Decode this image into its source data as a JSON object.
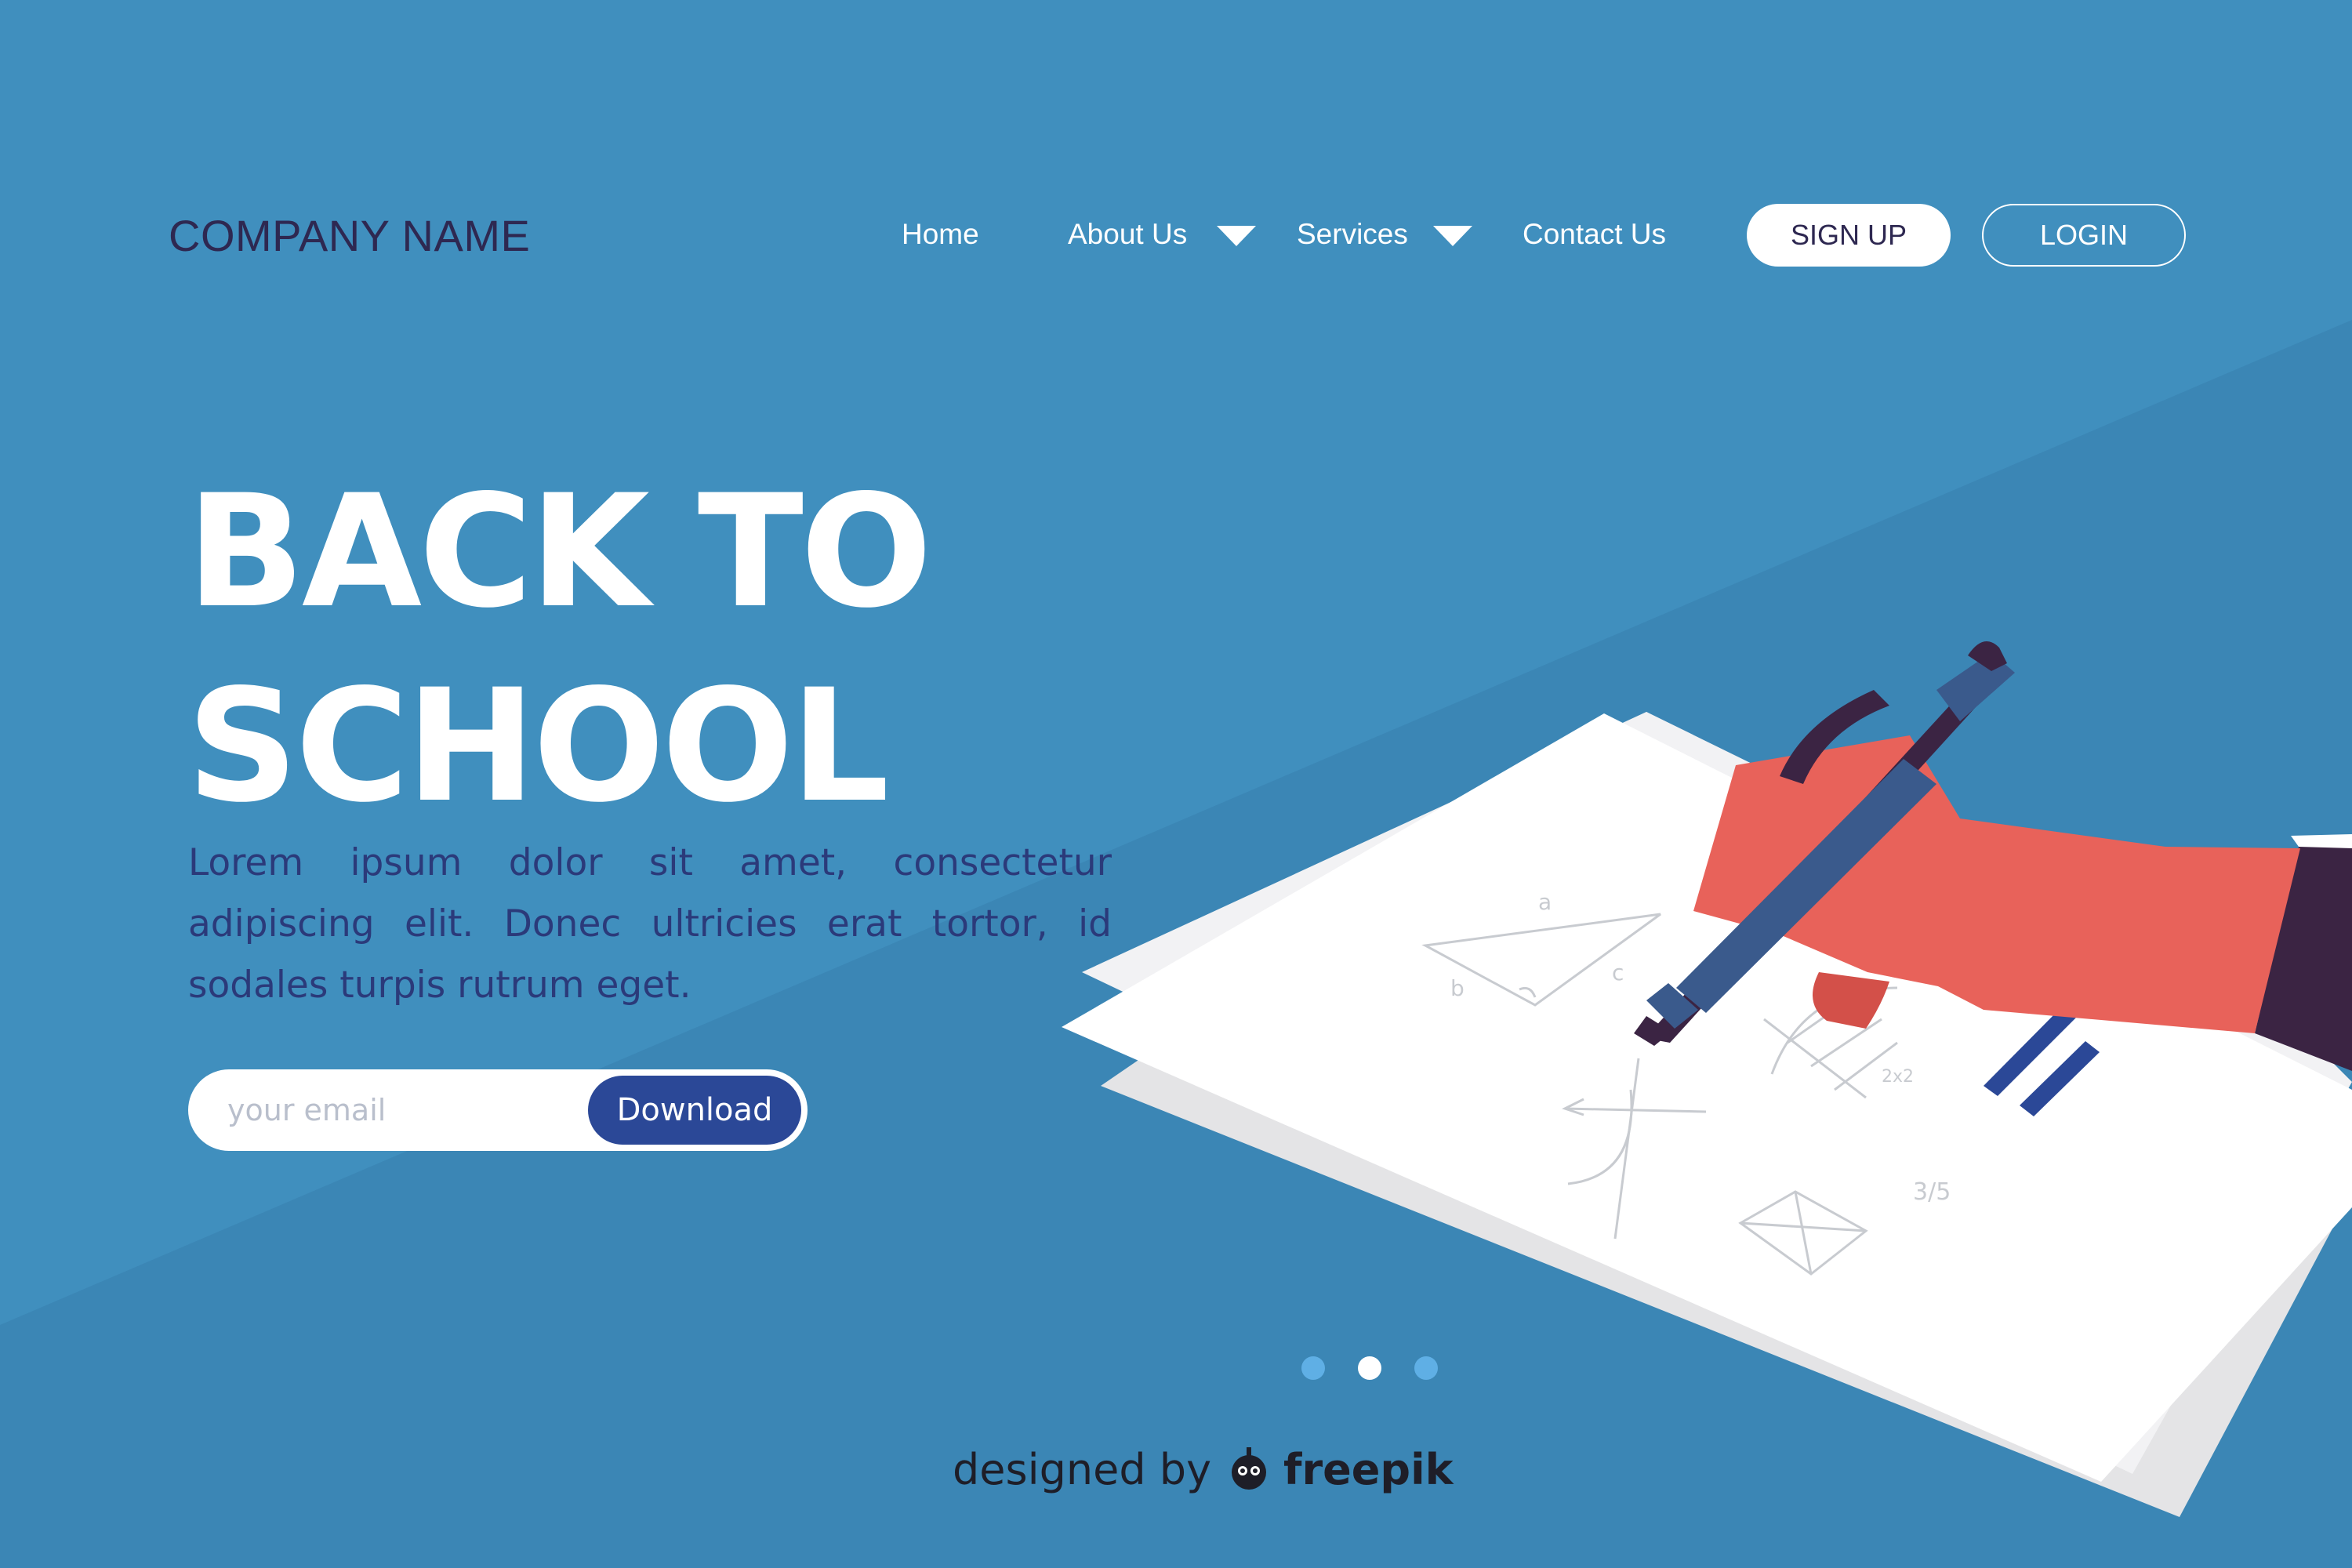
{
  "header": {
    "logo": "COMPANY NAME",
    "nav": [
      {
        "label": "Home"
      },
      {
        "label": "About Us"
      },
      {
        "label": "Services"
      },
      {
        "label": "Contact Us"
      }
    ],
    "signup_label": "SIGN UP",
    "login_label": "LOGIN"
  },
  "hero": {
    "title_line1": "BACK TO",
    "title_line2": "SCHOOL",
    "body": "Lorem ipsum dolor sit amet, consectetur adipiscing elit. Donec ultricies erat tortor, id sodales turpis rutrum eget.",
    "email_placeholder": "your email",
    "download_label": "Download"
  },
  "carousel": {
    "slide_count": 3,
    "active_slide": 2
  },
  "footer": {
    "credit_prefix": "designed by",
    "credit_brand": "freepik"
  },
  "illustration": {
    "sketch_labels": [
      "a",
      "b",
      "c",
      "2x2",
      "3/5"
    ]
  },
  "colors": {
    "background": "#408FBE",
    "logo": "#2E2851",
    "accent_button": "#2B4897",
    "hand": "#E8625A",
    "pen": "#3E2A4E",
    "dot_inactive": "#5FAFE5"
  },
  "icons": [
    "chevron-down-icon",
    "freepik-logo-icon"
  ]
}
